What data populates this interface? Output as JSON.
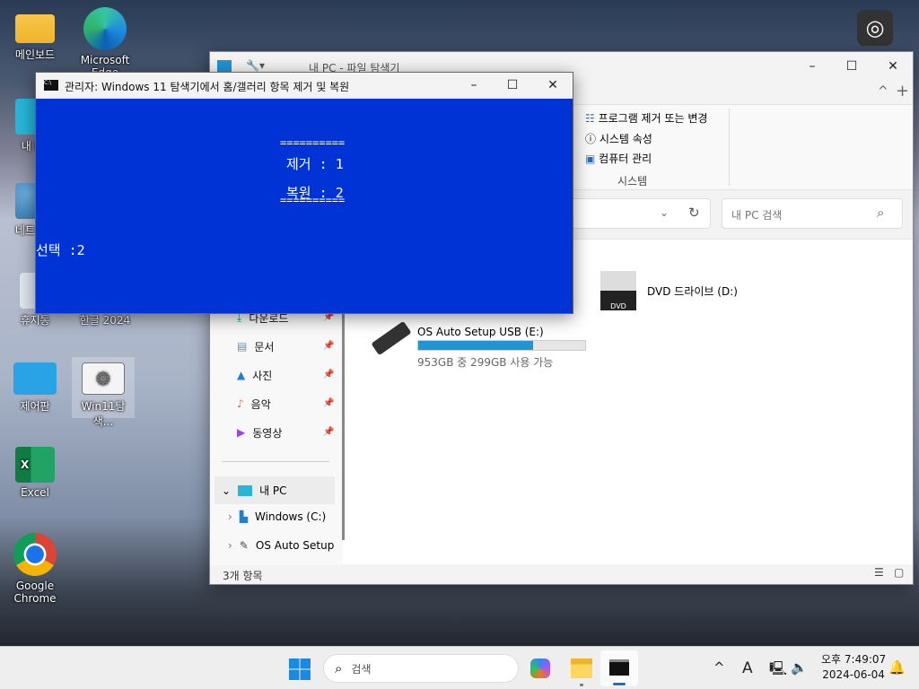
{
  "desktop": {
    "icons": [
      {
        "label": "메인보드",
        "icon": "folder-icon"
      },
      {
        "label": "Microsoft Edge",
        "icon": "edge-icon"
      },
      {
        "label": "내 PC",
        "icon": "computer-icon"
      },
      {
        "label": "네트워크",
        "icon": "network-icon"
      },
      {
        "label": "휴지통",
        "icon": "recycle-bin-icon"
      },
      {
        "label": "한글 2024",
        "icon": "hangul-icon"
      },
      {
        "label": "제어판",
        "icon": "control-panel-icon"
      },
      {
        "label": "Win11탐색...",
        "icon": "settings-shortcut-icon"
      },
      {
        "label": "Excel",
        "icon": "excel-icon"
      },
      {
        "label": "Google Chrome",
        "icon": "chrome-icon"
      }
    ]
  },
  "explorer": {
    "title": "내 PC - 파일 탐색기",
    "ribbon": {
      "items": [
        "프로그램 제거 또는 변경",
        "시스템 속성",
        "컴퓨터 관리"
      ],
      "group": "시스템"
    },
    "search_placeholder": "내 PC 검색",
    "nav": [
      "다운로드",
      "문서",
      "사진",
      "음악",
      "동영상"
    ],
    "tree": {
      "root": "내 PC",
      "children": [
        "Windows (C:)",
        "OS Auto Setup USB (E:)"
      ]
    },
    "drives": [
      {
        "name": "DVD 드라이브 (D:)"
      },
      {
        "name": "OS Auto Setup USB (E:)",
        "usage_text": "953GB 중 299GB 사용 가능",
        "used_percent": 68.6
      }
    ],
    "status": "3개 항목",
    "accent": "#1f95d3"
  },
  "cmd": {
    "title": "관리자:  Windows 11 탐색기에서 홈/갤러리 항목 제거 및 복원",
    "bg": "#0033d6",
    "lines": {
      "sep": "==========",
      "remove": "제거 : 1",
      "restore": "복원 : 2",
      "prompt": "선택 :2"
    }
  },
  "taskbar": {
    "search": "검색",
    "time": "오후 7:49:07",
    "date": "2024-06-04",
    "ime": "A"
  }
}
